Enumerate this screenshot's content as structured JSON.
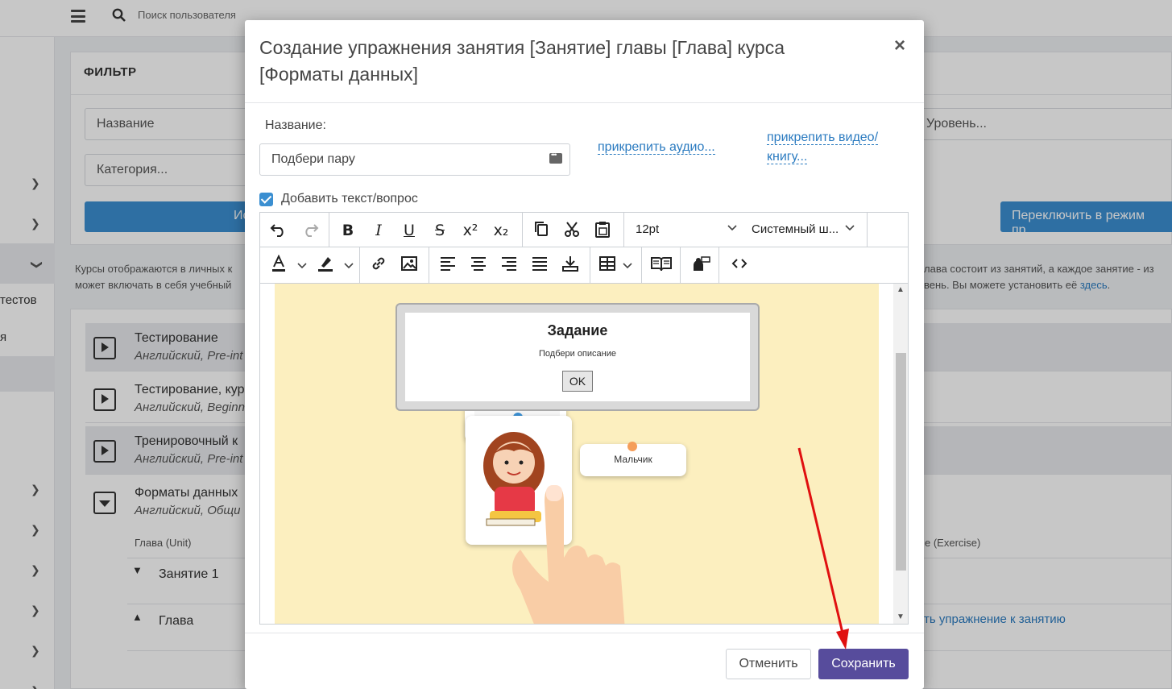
{
  "topbar": {
    "search_placeholder": "Поиск пользователя"
  },
  "sidebar": {
    "partial_label_1": "тестов",
    "partial_label_2": "я"
  },
  "filter": {
    "title": "ФИЛЬТР",
    "name_placeholder": "Название",
    "category_placeholder": "Категория...",
    "level_placeholder": "Уровень...",
    "search_button": "Искать",
    "switch_mode_button": "Переключить в режим пр"
  },
  "info": {
    "left_line1": "Курсы отображаются в личных к",
    "left_line2": "может включать в себя учебный",
    "right_line1": "лава состоит из занятий, а каждое занятие - из",
    "right_line2": "вень. Вы можете установить её",
    "right_link": "здесь"
  },
  "courses": [
    {
      "name": "Тестирование",
      "subtitle": "Английский, Pre-int"
    },
    {
      "name": "Тестирование, кур",
      "subtitle": "Английский, Beginn"
    },
    {
      "name": "Тренировочный к",
      "subtitle": "Английский, Pre-int"
    },
    {
      "name": "Форматы данных",
      "subtitle": "Английский, Общи"
    }
  ],
  "units": {
    "col_unit": "Глава (Unit)",
    "col_exercise": "е (Exercise)",
    "lesson1": "Занятие 1",
    "chapter": "Глава",
    "add_exercise_link": "ть упражнение к занятию"
  },
  "modal": {
    "title": "Создание упражнения занятия [Занятие] главы [Глава] курса [Форматы данных]",
    "name_label": "Название:",
    "name_value": "Подбери пару",
    "attach_audio": "прикрепить аудио...",
    "attach_video_line1": "прикрепить видео/",
    "attach_video_line2": "книгу...",
    "add_text_checkbox": "Добавить текст/вопрос",
    "add_text_checked": true,
    "font_size": "12pt",
    "font_family": "Системный ш...",
    "cancel_button": "Отменить",
    "save_button": "Сохранить"
  },
  "exercise_preview": {
    "dialog_title": "Задание",
    "dialog_text": "Подбери описание",
    "dialog_ok": "OK",
    "card_label": "Мальчик"
  },
  "colors": {
    "primary": "#3b8fd1",
    "save": "#574c9c",
    "link": "#2b7bc0",
    "arrow": "#e01010"
  }
}
